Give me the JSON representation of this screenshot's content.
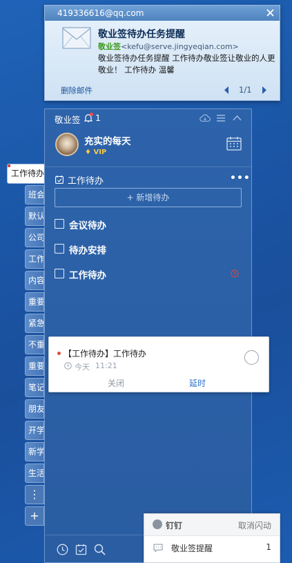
{
  "email_popup": {
    "account": "419336616@qq.com",
    "subject": "敬业签待办任务提醒",
    "sender_name": "敬业签",
    "sender_address": "<kefu@serve.jingyeqian.com>",
    "body": "敬业签待办任务提醒  工作待办敬业签让敬业的人更敬业！ 工作待办  温馨",
    "delete_label": "删除邮件",
    "page": "1/1"
  },
  "side_tabs": {
    "active": "工作待办",
    "items": [
      "班会",
      "默认",
      "公司",
      "工作",
      "内容",
      "重要",
      "紧急",
      "不重",
      "重要",
      "笔记",
      "朋友",
      "开学",
      "新学",
      "生活"
    ],
    "more": "⋮",
    "add": "+"
  },
  "panel": {
    "app_title": "敬业签",
    "notification_count": "1",
    "user_name": "充实的每天",
    "vip": "VIP",
    "section_title": "工作待办",
    "more": "•••",
    "add_button": "+ 新增待办",
    "todos": [
      "会议待办",
      "待办安排",
      "工作待办"
    ]
  },
  "reminder": {
    "title": "【工作待办】工作待办",
    "day": "今天",
    "time": "11:21",
    "close": "关闭",
    "delay": "延时"
  },
  "dingtalk": {
    "app": "钉钉",
    "cancel_flash": "取消闪动",
    "message_label": "敬业签提醒",
    "message_count": "1"
  },
  "colors": {
    "desktop": "#1b56a6",
    "panel": "#2c60a8",
    "accent": "#2a6fc9",
    "vip": "#f7c948",
    "sender": "#3c9a1a",
    "alarm": "#e0443c"
  }
}
